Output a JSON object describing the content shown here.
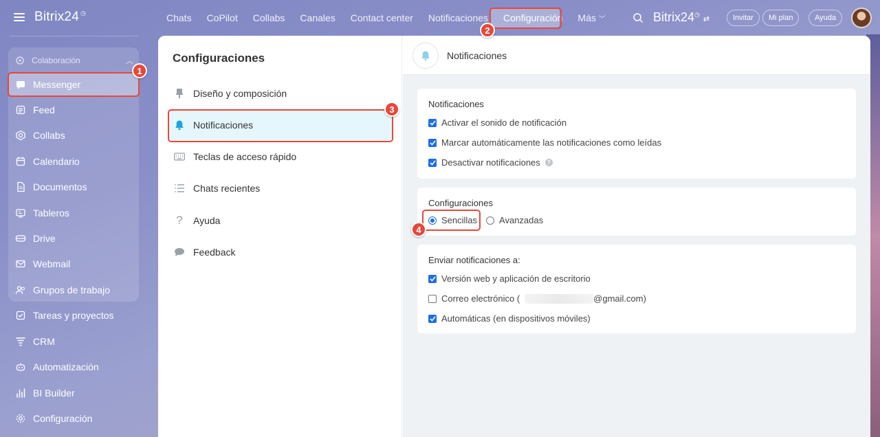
{
  "sidebar": {
    "brand": "Bitrix24",
    "group_label": "Colaboración",
    "items": [
      {
        "label": "Messenger",
        "icon": "chat-icon"
      },
      {
        "label": "Feed",
        "icon": "feed-icon"
      },
      {
        "label": "Collabs",
        "icon": "hexagon-icon"
      },
      {
        "label": "Calendario",
        "icon": "calendar-icon"
      },
      {
        "label": "Documentos",
        "icon": "document-icon"
      },
      {
        "label": "Tableros",
        "icon": "board-icon"
      },
      {
        "label": "Drive",
        "icon": "drive-icon"
      },
      {
        "label": "Webmail",
        "icon": "mail-icon"
      },
      {
        "label": "Grupos de trabajo",
        "icon": "group-icon"
      },
      {
        "label": "Tareas y proyectos",
        "icon": "task-icon"
      },
      {
        "label": "CRM",
        "icon": "crm-icon"
      },
      {
        "label": "Automatización",
        "icon": "robot-icon"
      },
      {
        "label": "BI Builder",
        "icon": "chart-icon"
      },
      {
        "label": "Configuración",
        "icon": "gear-icon"
      }
    ]
  },
  "topbar": {
    "nav": [
      "Chats",
      "CoPilot",
      "Collabs",
      "Canales",
      "Contact center",
      "Notificaciones",
      "Configuración",
      "Más"
    ],
    "brand": "Bitrix24",
    "invite": "Invitar",
    "plan": "Mi plan",
    "help": "Ayuda"
  },
  "settings": {
    "title": "Configuraciones",
    "menu": [
      {
        "label": "Diseño y composición",
        "icon": "brush-icon"
      },
      {
        "label": "Notificaciones",
        "icon": "bell-icon"
      },
      {
        "label": "Teclas de acceso rápido",
        "icon": "keyboard-icon"
      },
      {
        "label": "Chats recientes",
        "icon": "list-icon"
      },
      {
        "label": "Ayuda",
        "icon": "question-icon"
      },
      {
        "label": "Feedback",
        "icon": "speech-bubble-icon"
      }
    ]
  },
  "notifications": {
    "header": "Notificaciones",
    "section1": {
      "title": "Notificaciones",
      "options": [
        {
          "label": "Activar el sonido de notificación",
          "checked": true
        },
        {
          "label": "Marcar automáticamente las notificaciones como leídas",
          "checked": true
        },
        {
          "label": "Desactivar notificaciones",
          "checked": true
        }
      ]
    },
    "section2": {
      "title": "Configuraciones",
      "radio_simple": "Sencillas",
      "radio_advanced": "Avanzadas",
      "selected": "Sencillas"
    },
    "section3": {
      "title": "Enviar notificaciones a:",
      "options": [
        {
          "label": "Versión web y aplicación de escritorio",
          "checked": true
        },
        {
          "label_prefix": "Correo electrónico (",
          "label_suffix": "@gmail.com)",
          "checked": false
        },
        {
          "label": "Automáticas (en dispositivos móviles)",
          "checked": true
        }
      ]
    }
  },
  "annotations": [
    "1",
    "2",
    "3",
    "4"
  ],
  "colors": {
    "accent": "#1d6ee8",
    "callout": "#e5483a",
    "active_menu": "#e5f6fc"
  }
}
